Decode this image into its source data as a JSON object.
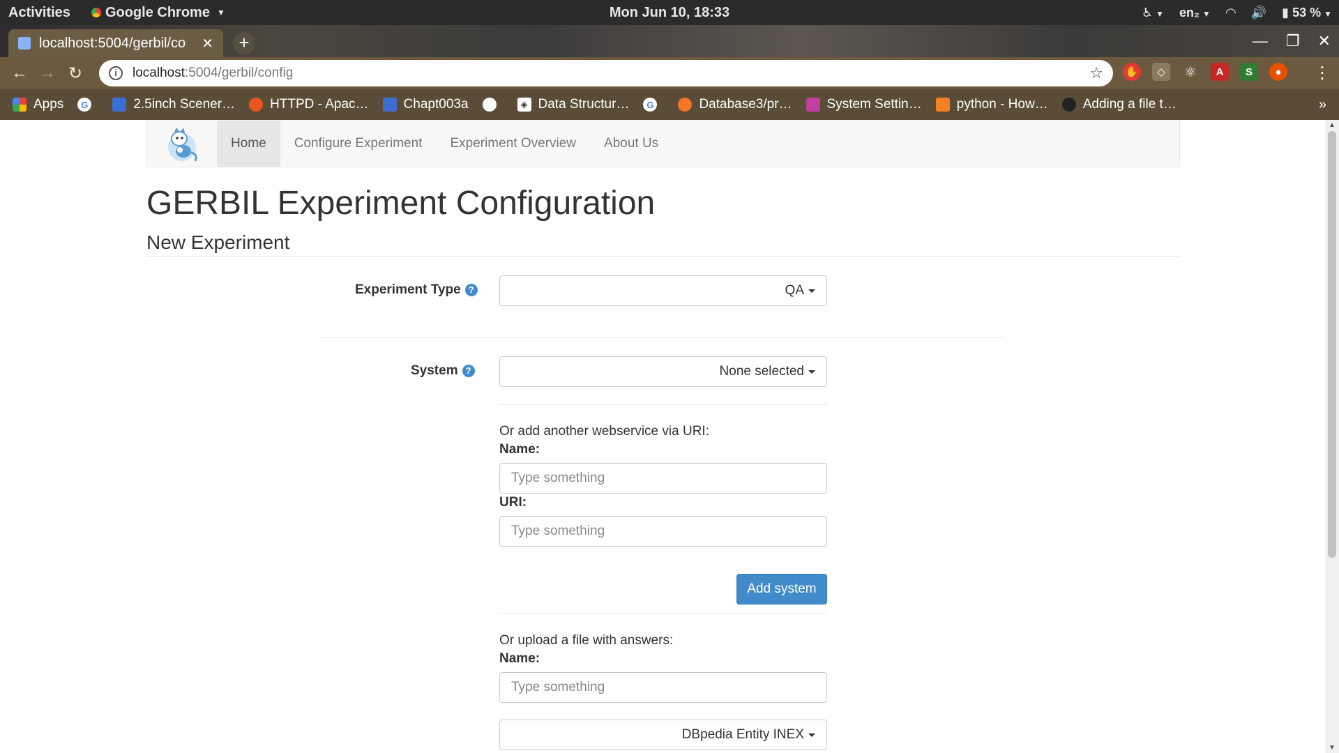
{
  "os": {
    "activities": "Activities",
    "app_name": "Google Chrome",
    "clock": "Mon Jun 10, 18:33",
    "lang": "en₂",
    "battery": "53 %"
  },
  "browser": {
    "tab_title": "localhost:5004/gerbil/co",
    "url_host": "localhost",
    "url_path": ":5004/gerbil/config",
    "bookmarks": [
      {
        "label": "Apps",
        "color": "#e94235"
      },
      {
        "label": "",
        "color": "#ffffff"
      },
      {
        "label": "2.5inch Scener…",
        "color": "#3a6fd8"
      },
      {
        "label": "HTTPD - Apac…",
        "color": "#e95420"
      },
      {
        "label": "Chapt003a",
        "color": "#3e6fcf"
      },
      {
        "label": "",
        "color": "#ffffff"
      },
      {
        "label": "Data Structur…",
        "color": "#ffffff"
      },
      {
        "label": "",
        "color": "#ffffff"
      },
      {
        "label": "Database3/pr…",
        "color": "#f37726"
      },
      {
        "label": "System Settin…",
        "color": "#c23fa0"
      },
      {
        "label": "python - How…",
        "color": "#f48024"
      },
      {
        "label": "Adding a file t…",
        "color": "#222222"
      }
    ]
  },
  "nav": {
    "items": [
      "Home",
      "Configure Experiment",
      "Experiment Overview",
      "About Us"
    ]
  },
  "main": {
    "title": "GERBIL Experiment Configuration",
    "subtitle": "New Experiment",
    "experiment_type_label": "Experiment Type",
    "experiment_type_value": "QA",
    "system_label": "System",
    "system_value": "None selected",
    "add_webservice_text": "Or add another webservice via URI:",
    "name_label": "Name:",
    "name_placeholder": "Type something",
    "uri_label": "URI:",
    "uri_placeholder": "Type something",
    "add_system_button": "Add system",
    "upload_text": "Or upload a file with answers:",
    "upload_name_label": "Name:",
    "upload_name_placeholder": "Type something",
    "dataset_value": "DBpedia Entity INEX"
  }
}
